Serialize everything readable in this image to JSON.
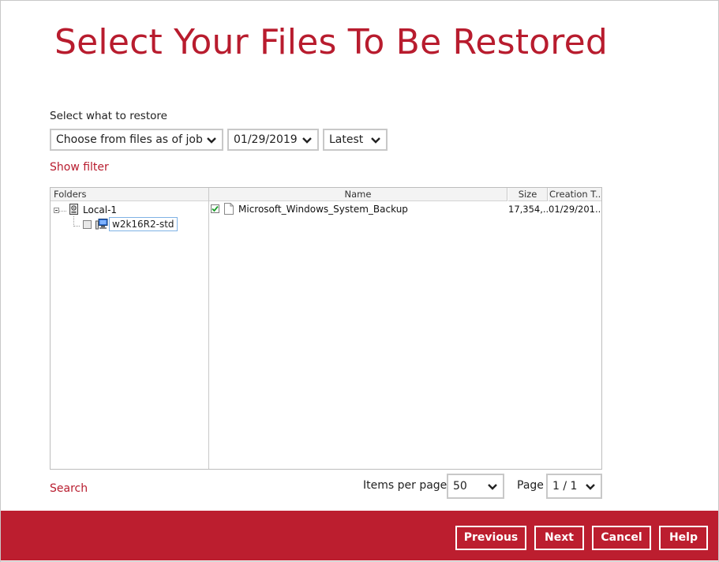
{
  "page": {
    "title": "Select Your Files To Be Restored",
    "select_label": "Select what to restore",
    "show_filter": "Show filter",
    "search": "Search"
  },
  "selectors": {
    "job_mode": "Choose from files as of job",
    "date": "01/29/2019",
    "version": "Latest"
  },
  "columns": {
    "folders": "Folders",
    "name": "Name",
    "size": "Size",
    "creation_time": "Creation T..."
  },
  "tree": {
    "root": {
      "label": "Local-1",
      "icon": "backup-destination-icon",
      "expanded": true
    },
    "child": {
      "label": "w2k16R2-std",
      "icon": "computer-icon",
      "checked": "partial",
      "selected": true
    }
  },
  "files": [
    {
      "name": "Microsoft_Windows_System_Backup",
      "size": "17,354,...",
      "creation_time": "01/29/201...",
      "checked": true,
      "icon": "file-icon"
    }
  ],
  "pagination": {
    "items_per_page_label": "Items per page",
    "items_per_page": "50",
    "page_label": "Page",
    "page": "1 / 1"
  },
  "footer": {
    "previous": "Previous",
    "next": "Next",
    "cancel": "Cancel",
    "help": "Help"
  },
  "colors": {
    "accent": "#b81c2e",
    "footer_bg": "#bc1e2f"
  }
}
